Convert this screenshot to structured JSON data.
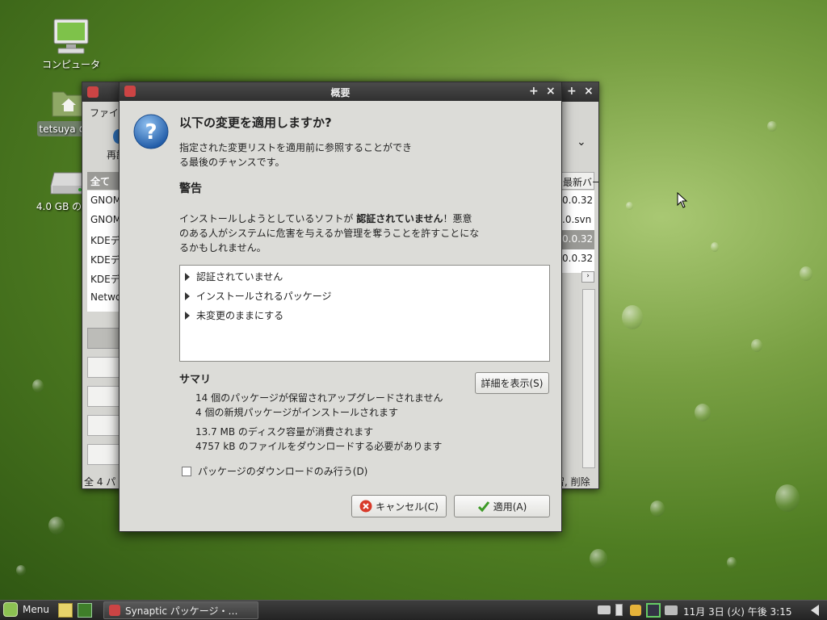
{
  "desktop": {
    "icons": [
      {
        "label": "コンピュータ"
      },
      {
        "label": "tetsuya の…"
      },
      {
        "label": "4.0 GB のメ…"
      }
    ]
  },
  "back_window": {
    "menu": "ファイ",
    "reload": "再読",
    "filter_header": "全て",
    "list": [
      "GNOM",
      "GNOM",
      "KDEデ",
      "KDEデ",
      "KDEデ",
      "Netwo"
    ],
    "col_header": "最新バー",
    "versions": [
      "0.0.32",
      ".0.svn",
      "0.0.32",
      "0.0.32"
    ],
    "status_left": "全 4 パ",
    "status_right": "留, 削除"
  },
  "dialog": {
    "title": "概要",
    "question": "以下の変更を適用しますか?",
    "intro_line1": "指定された変更リストを適用前に参照することができ",
    "intro_line2": "る最後のチャンスです。",
    "warning_heading": "警告",
    "warning_pre": "インストールしようとしているソフトが ",
    "warning_bold": "認証されていません",
    "warning_post": "！悪意",
    "warning_line2": "のある人がシステムに危害を与えるか管理を奪うことを許すことにな",
    "warning_line3": "るかもしれません。",
    "tree_items": [
      "認証されていません",
      "インストールされるパッケージ",
      "未変更のままにする"
    ],
    "summary_heading": "サマリ",
    "details_button": "詳細を表示(S)",
    "summary_line1": "14 個のパッケージが保留されアップグレードされません",
    "summary_line2": "4 個の新規パッケージがインストールされます",
    "summary_line3": "13.7 MB のディスク容量が消費されます",
    "summary_line4": "4757 kB のファイルをダウンロードする必要があります",
    "download_only_label": "パッケージのダウンロードのみ行う(D)",
    "download_only_checked": false,
    "cancel_button": "キャンセル(C)",
    "apply_button": "適用(A)"
  },
  "panel": {
    "menu_label": "Menu",
    "task_label": "Synaptic パッケージ・…",
    "clock": "11月 3日 (火) 午後 3:15"
  },
  "colors": {
    "desktop_green": "#5b8a2c",
    "titlebar": "#3a3a3a",
    "cancel_red": "#d83a2a",
    "apply_green": "#3c9a25",
    "question_blue": "#2d6fb8"
  }
}
